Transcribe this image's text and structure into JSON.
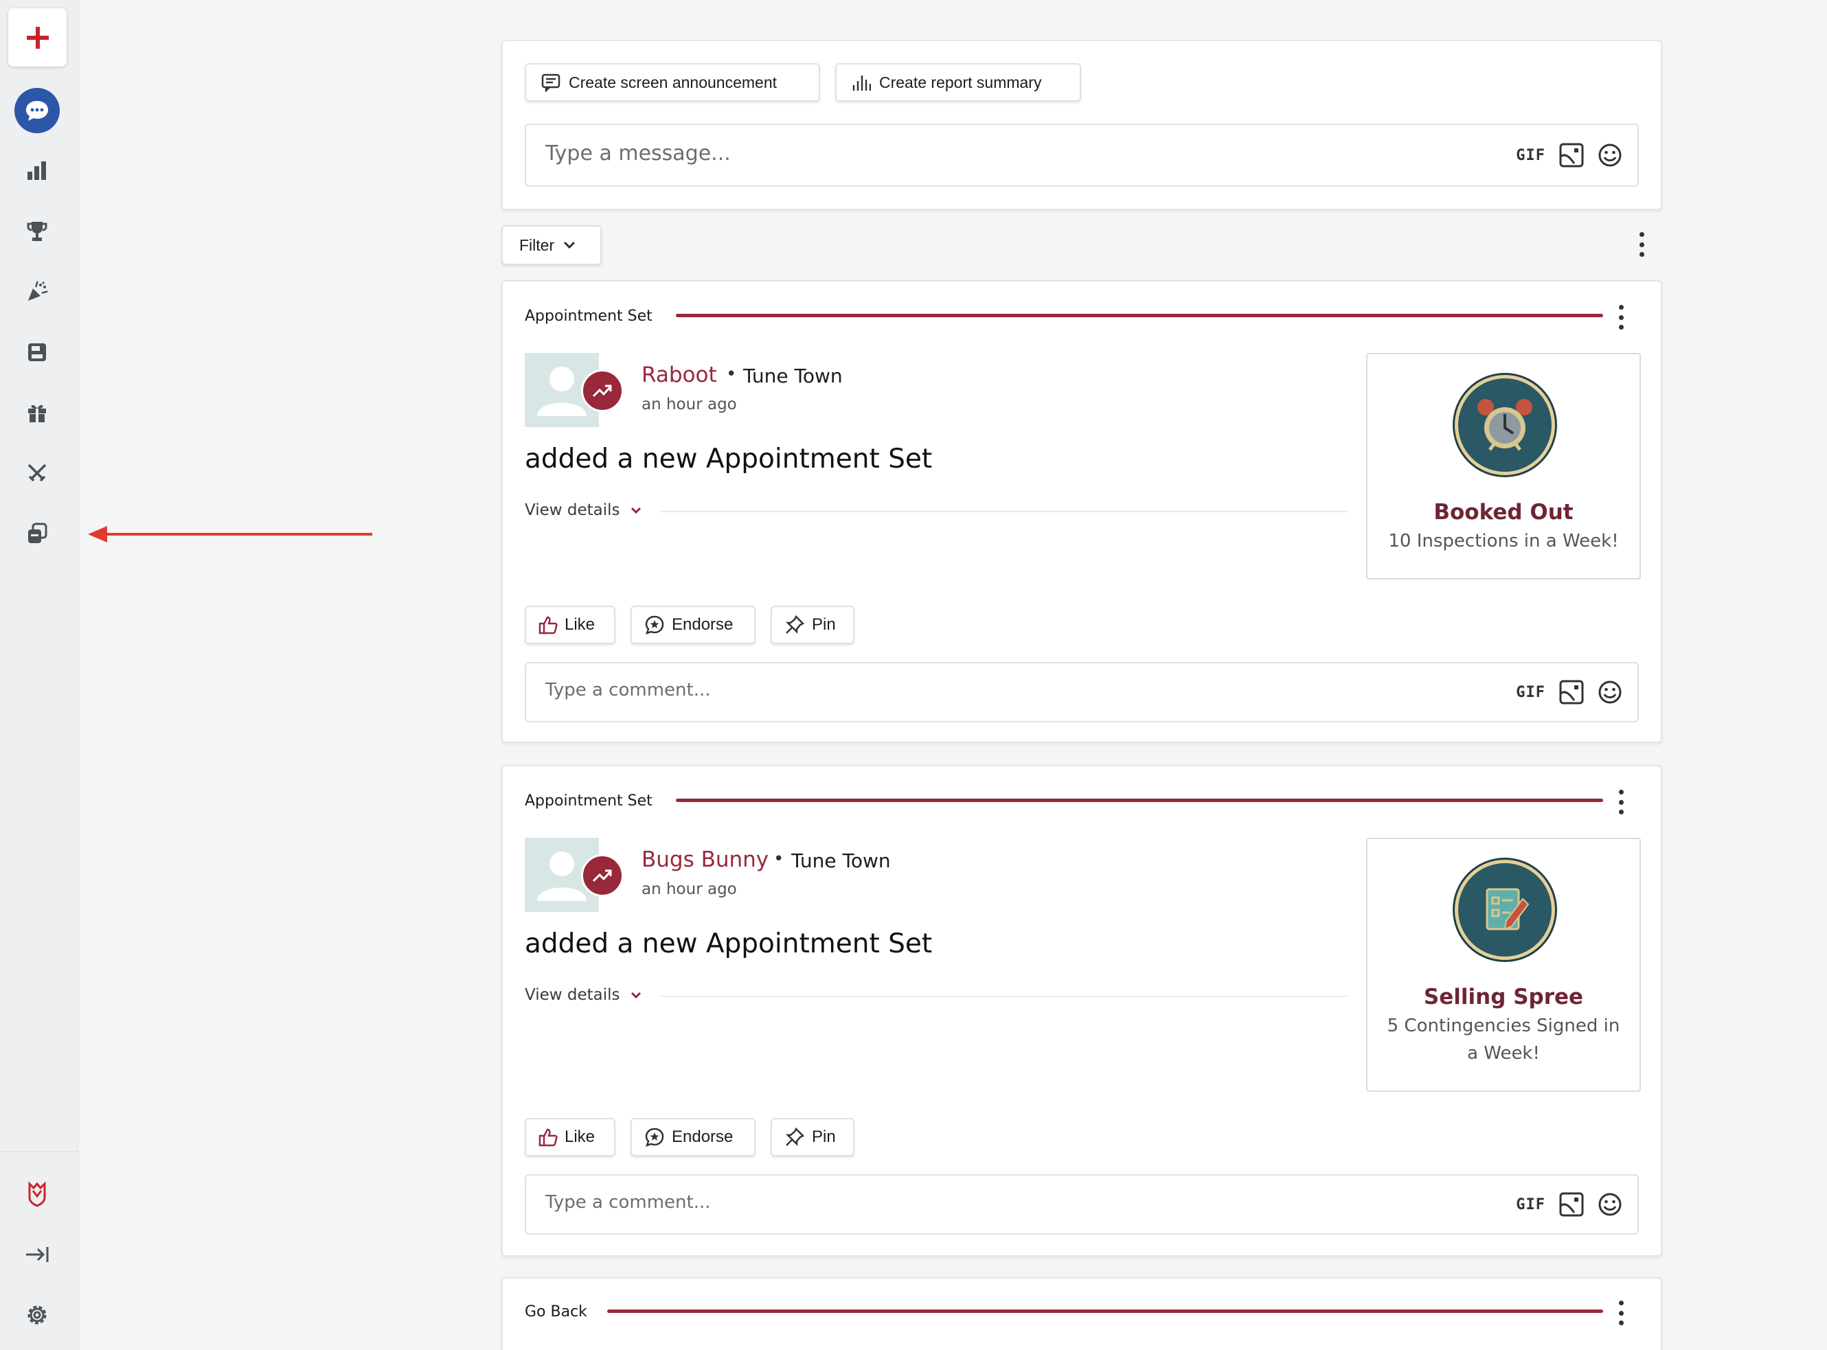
{
  "composer": {
    "announcement_label": "Create screen announcement",
    "report_label": "Create report summary",
    "message_placeholder": "Type a message...",
    "gif_label": "GIF"
  },
  "filter": {
    "label": "Filter"
  },
  "posts": [
    {
      "category": "Appointment Set",
      "user": "Raboot",
      "separator": "•",
      "team": "Tune Town",
      "time": "an hour ago",
      "headline": "added a new Appointment Set",
      "view_details": "View details",
      "achievement": {
        "title": "Booked Out",
        "subtitle": "10 Inspections in a Week!",
        "icon": "alarm-clock-icon"
      },
      "actions": {
        "like": "Like",
        "endorse": "Endorse",
        "pin": "Pin"
      },
      "comment_placeholder": "Type a comment...",
      "gif_label": "GIF"
    },
    {
      "category": "Appointment Set",
      "user": "Bugs Bunny",
      "separator": "•",
      "team": "Tune Town",
      "time": "an hour ago",
      "headline": "added a new Appointment Set",
      "view_details": "View details",
      "achievement": {
        "title": "Selling Spree",
        "subtitle": "5 Contingencies Signed in a Week!",
        "icon": "checklist-pencil-icon"
      },
      "actions": {
        "like": "Like",
        "endorse": "Endorse",
        "pin": "Pin"
      },
      "comment_placeholder": "Type a comment...",
      "gif_label": "GIF"
    },
    {
      "category": "Go Back"
    }
  ],
  "sidebar": {
    "icons": [
      "plus-icon",
      "chat-icon",
      "bar-chart-icon",
      "trophy-icon",
      "party-popper-icon",
      "save-icon",
      "gift-icon",
      "crossed-swords-icon",
      "cards-icon",
      "brand-logo-icon",
      "collapse-sidebar-icon",
      "settings-icon"
    ]
  },
  "colors": {
    "accent": "#98283a",
    "chat_active": "#2c56a8",
    "annotation_arrow": "#e23b2e"
  }
}
